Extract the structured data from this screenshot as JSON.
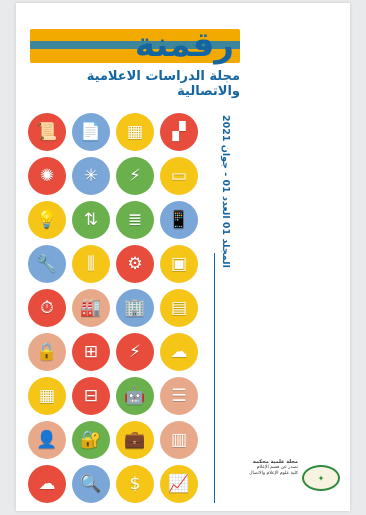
{
  "masthead": {
    "logo_word": "رقمنة",
    "journal_title": "مجلة الدراسات الاعلامية والاتصالية"
  },
  "issue_info": "المجلد 01 العدد 01 - جوان 2021",
  "icons": [
    {
      "name": "certificate-icon",
      "glyph": "📜",
      "color": "#e74c3c"
    },
    {
      "name": "document-scan-icon",
      "glyph": "📄",
      "color": "#7aa6d8"
    },
    {
      "name": "microchip-icon",
      "glyph": "▦",
      "color": "#f5c518"
    },
    {
      "name": "windows-icon",
      "glyph": "▞",
      "color": "#e74c3c"
    },
    {
      "name": "sun-network-icon",
      "glyph": "✺",
      "color": "#e74c3c"
    },
    {
      "name": "network-hub-icon",
      "glyph": "✳",
      "color": "#7aa6d8"
    },
    {
      "name": "plug-icon",
      "glyph": "⚡",
      "color": "#6ab04c"
    },
    {
      "name": "computer-icon",
      "glyph": "▭",
      "color": "#f5c518"
    },
    {
      "name": "lightbulb-icon",
      "glyph": "💡",
      "color": "#f5c518"
    },
    {
      "name": "money-transfer-icon",
      "glyph": "⇅",
      "color": "#6ab04c"
    },
    {
      "name": "server-icon",
      "glyph": "≣",
      "color": "#6ab04c"
    },
    {
      "name": "phone-settings-icon",
      "glyph": "📱",
      "color": "#7aa6d8"
    },
    {
      "name": "wrench-icon",
      "glyph": "🔧",
      "color": "#7aa6d8"
    },
    {
      "name": "equalizer-icon",
      "glyph": "⫼",
      "color": "#f5c518"
    },
    {
      "name": "gear-icon",
      "glyph": "⚙",
      "color": "#e74c3c"
    },
    {
      "name": "cpu-icon",
      "glyph": "▣",
      "color": "#f5c518"
    },
    {
      "name": "stopwatch-icon",
      "glyph": "⏱",
      "color": "#e74c3c"
    },
    {
      "name": "factory-icon",
      "glyph": "🏭",
      "color": "#e8a98a"
    },
    {
      "name": "building-icon",
      "glyph": "🏢",
      "color": "#7aa6d8"
    },
    {
      "name": "calendar-icon",
      "glyph": "▤",
      "color": "#f5c518"
    },
    {
      "name": "document-lock-icon",
      "glyph": "🔒",
      "color": "#e8a98a"
    },
    {
      "name": "flowchart-icon",
      "glyph": "⊞",
      "color": "#e74c3c"
    },
    {
      "name": "power-plant-icon",
      "glyph": "⚡",
      "color": "#e74c3c"
    },
    {
      "name": "cloud-network-icon",
      "glyph": "☁",
      "color": "#f5c518"
    },
    {
      "name": "server-rack-icon",
      "glyph": "▦",
      "color": "#f5c518"
    },
    {
      "name": "conveyor-icon",
      "glyph": "⊟",
      "color": "#e74c3c"
    },
    {
      "name": "robot-icon",
      "glyph": "🤖",
      "color": "#6ab04c"
    },
    {
      "name": "storage-icon",
      "glyph": "☰",
      "color": "#e8a98a"
    },
    {
      "name": "user-settings-icon",
      "glyph": "👤",
      "color": "#e8a98a"
    },
    {
      "name": "security-lock-icon",
      "glyph": "🔐",
      "color": "#6ab04c"
    },
    {
      "name": "briefcase-icon",
      "glyph": "💼",
      "color": "#f5c518"
    },
    {
      "name": "barcode-icon",
      "glyph": "▥",
      "color": "#e8a98a"
    },
    {
      "name": "cloud-upload-icon",
      "glyph": "☁",
      "color": "#e74c3c"
    },
    {
      "name": "magnifier-icon",
      "glyph": "🔍",
      "color": "#7aa6d8"
    },
    {
      "name": "money-bag-icon",
      "glyph": "$",
      "color": "#f5c518"
    },
    {
      "name": "analytics-icon",
      "glyph": "📈",
      "color": "#f5c518"
    }
  ],
  "publisher": {
    "line1": "مجلة علمية محكمة",
    "line2": "تصدر عن قسم الإعلام",
    "line3": "كلية علوم الإعلام والاتصال"
  }
}
